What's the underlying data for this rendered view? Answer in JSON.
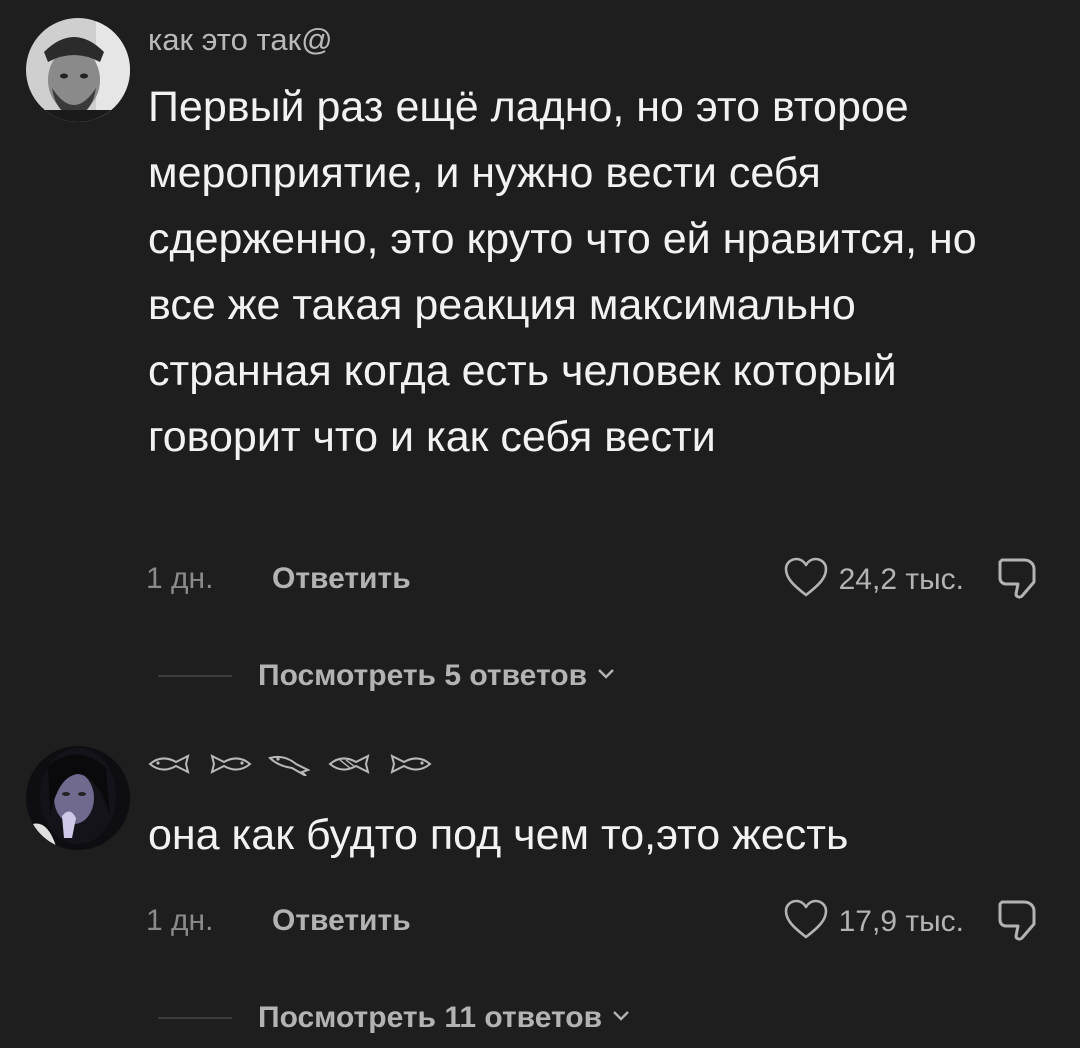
{
  "comments": [
    {
      "username": "как это так@",
      "text": "Первый раз ещё ладно, но это второе мероприятие, и нужно вести себя сдерженно, это круто что ей нравится, но все же такая реакция максимально странная когда есть человек который говорит что и как себя вести",
      "time": "1 дн.",
      "reply_label": "Ответить",
      "likes": "24,2 тыс.",
      "view_replies": "Посмотреть 5 ответов"
    },
    {
      "username_icons": [
        "fish-icon",
        "fish-icon",
        "fish-icon",
        "fish-icon",
        "fish-icon"
      ],
      "text": "она как будто под чем то,это жесть",
      "time": "1 дн.",
      "reply_label": "Ответить",
      "likes": "17,9 тыс.",
      "view_replies": "Посмотреть 11 ответов"
    }
  ],
  "colors": {
    "background": "#1e1e1e",
    "text_primary": "#f2f2f2",
    "text_secondary": "#b3b3b3",
    "text_muted": "#8b8b8b"
  }
}
